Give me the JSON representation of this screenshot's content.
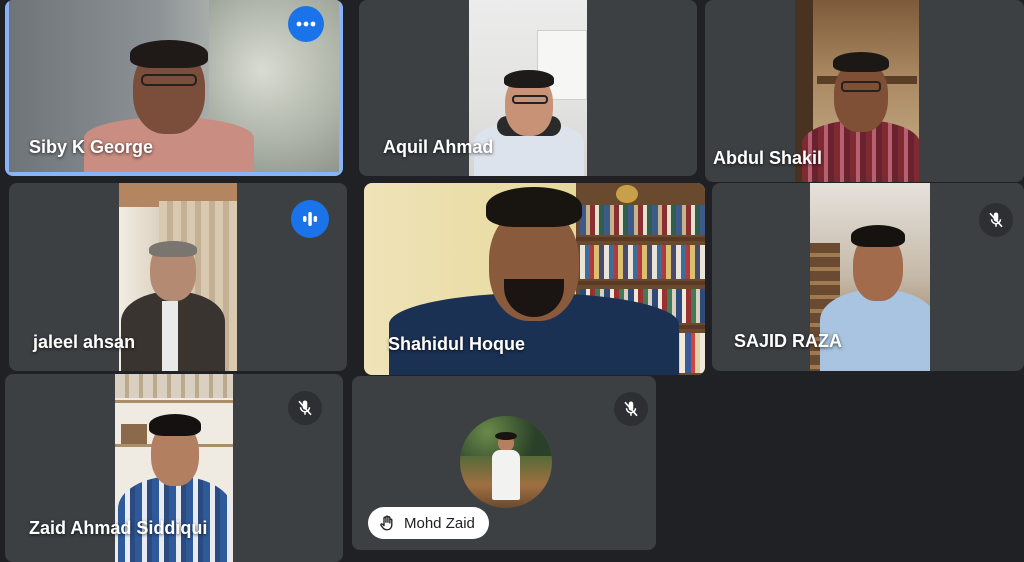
{
  "participants": [
    {
      "id": "p1",
      "name": "Siby K George",
      "status": "options"
    },
    {
      "id": "p2",
      "name": "Aquil Ahmad"
    },
    {
      "id": "p3",
      "name": "Abdul Shakil"
    },
    {
      "id": "p4",
      "name": "jaleel ahsan",
      "status": "speaking"
    },
    {
      "id": "p5",
      "name": "Shahidul Hoque"
    },
    {
      "id": "p6",
      "name": "SAJID RAZA",
      "status": "muted"
    },
    {
      "id": "p7",
      "name": "Zaid Ahmad Siddiqui",
      "status": "muted"
    },
    {
      "id": "p8",
      "name": "Mohd Zaid",
      "status": "muted",
      "hand_raised": true
    }
  ],
  "icons": {
    "options": "more-options-icon",
    "speaking": "audio-level-icon",
    "muted": "mic-off-icon",
    "hand": "raised-hand-icon"
  },
  "colors": {
    "background": "#202124",
    "tile": "#3c4043",
    "active_border": "#8ab4f8",
    "accent": "#1a73e8"
  }
}
